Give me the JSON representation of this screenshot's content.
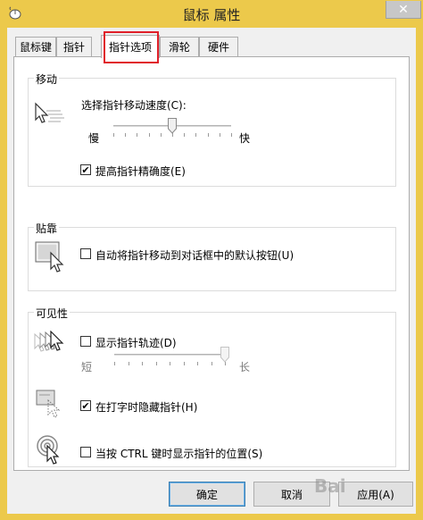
{
  "window": {
    "title": "鼠标 属性",
    "close_glyph": "✕",
    "frame_color": "#ecc94b"
  },
  "tabs": [
    {
      "label": "鼠标键"
    },
    {
      "label": "指针"
    },
    {
      "label": "指针选项",
      "active": true
    },
    {
      "label": "滑轮"
    },
    {
      "label": "硬件"
    }
  ],
  "motion": {
    "title": "移动",
    "speed_label": "选择指针移动速度(C):",
    "slow_label": "慢",
    "fast_label": "快",
    "speed_value_fraction": 0.5,
    "precision_label": "提高指针精确度(E)",
    "precision_checked": true,
    "icon": "pointer-speed-icon"
  },
  "snap": {
    "title": "贴靠",
    "snap_label": "自动将指针移动到对话框中的默认按钮(U)",
    "snap_checked": false,
    "icon": "snap-to-button-icon"
  },
  "visibility": {
    "title": "可见性",
    "trails_label": "显示指针轨迹(D)",
    "trails_checked": false,
    "short_label": "短",
    "long_label": "长",
    "trails_value_fraction": 1.0,
    "hide_typing_label": "在打字时隐藏指针(H)",
    "hide_typing_checked": true,
    "ctrl_label": "当按 CTRL 键时显示指针的位置(S)",
    "ctrl_checked": false,
    "icons": [
      "pointer-trails-icon",
      "hide-while-typing-icon",
      "ctrl-locate-icon"
    ]
  },
  "buttons": {
    "ok": "确定",
    "cancel": "取消",
    "apply": "应用(A)"
  },
  "checkmark": "✔",
  "highlight_color": "#e0202a",
  "watermark_text": "Bai"
}
